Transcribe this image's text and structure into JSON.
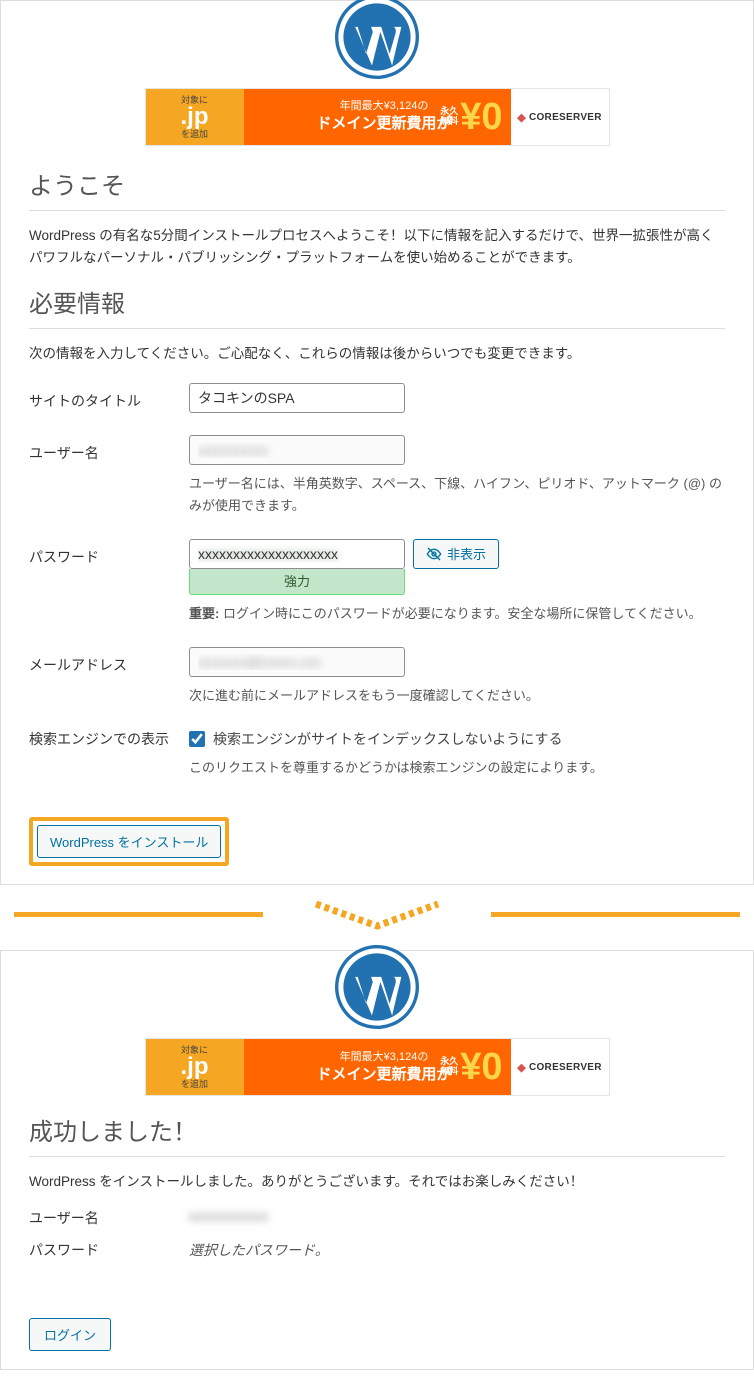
{
  "banner": {
    "left_top": "対象に",
    "left_jp": ".jp",
    "left_bottom": "を追加",
    "mid_line1": "年間最大¥3,124の",
    "mid_line2": "ドメイン更新費用が",
    "price_tag1": "永久",
    "price_tag2": "無料",
    "price_value": "¥0",
    "right_brand": "CORESERVER"
  },
  "install": {
    "welcome_title": "ようこそ",
    "welcome_text": "WordPress の有名な5分間インストールプロセスへようこそ！以下に情報を記入するだけで、世界一拡張性が高くパワフルなパーソナル・パブリッシング・プラットフォームを使い始めることができます。",
    "info_title": "必要情報",
    "info_text": "次の情報を入力してください。ご心配なく、これらの情報は後からいつでも変更できます。",
    "site_title_label": "サイトのタイトル",
    "site_title_value": "タコキンのSPA",
    "username_label": "ユーザー名",
    "username_value": "xxxxxxxxxx",
    "username_hint": "ユーザー名には、半角英数字、スペース、下線、ハイフン、ピリオド、アットマーク (@) のみが使用できます。",
    "password_label": "パスワード",
    "password_value": "xxxxxxxxxxxxxxxxxxxx",
    "password_strength": "強力",
    "hide_button": "非表示",
    "password_hint_strong": "重要:",
    "password_hint": " ログイン時にこのパスワードが必要になります。安全な場所に保管してください。",
    "email_label": "メールアドレス",
    "email_value": "xxxxxxx@xxxxx.xxx",
    "email_hint": "次に進む前にメールアドレスをもう一度確認してください。",
    "se_label": "検索エンジンでの表示",
    "se_checkbox_label": "検索エンジンがサイトをインデックスしないようにする",
    "se_hint": "このリクエストを尊重するかどうかは検索エンジンの設定によります。",
    "submit": "WordPress をインストール"
  },
  "success": {
    "title": "成功しました！",
    "text": "WordPress をインストールしました。ありがとうございます。それではお楽しみください！",
    "username_label": "ユーザー名",
    "username_value": "xxxxxxxxxx",
    "password_label": "パスワード",
    "password_value": "選択したパスワード。",
    "login": "ログイン"
  }
}
